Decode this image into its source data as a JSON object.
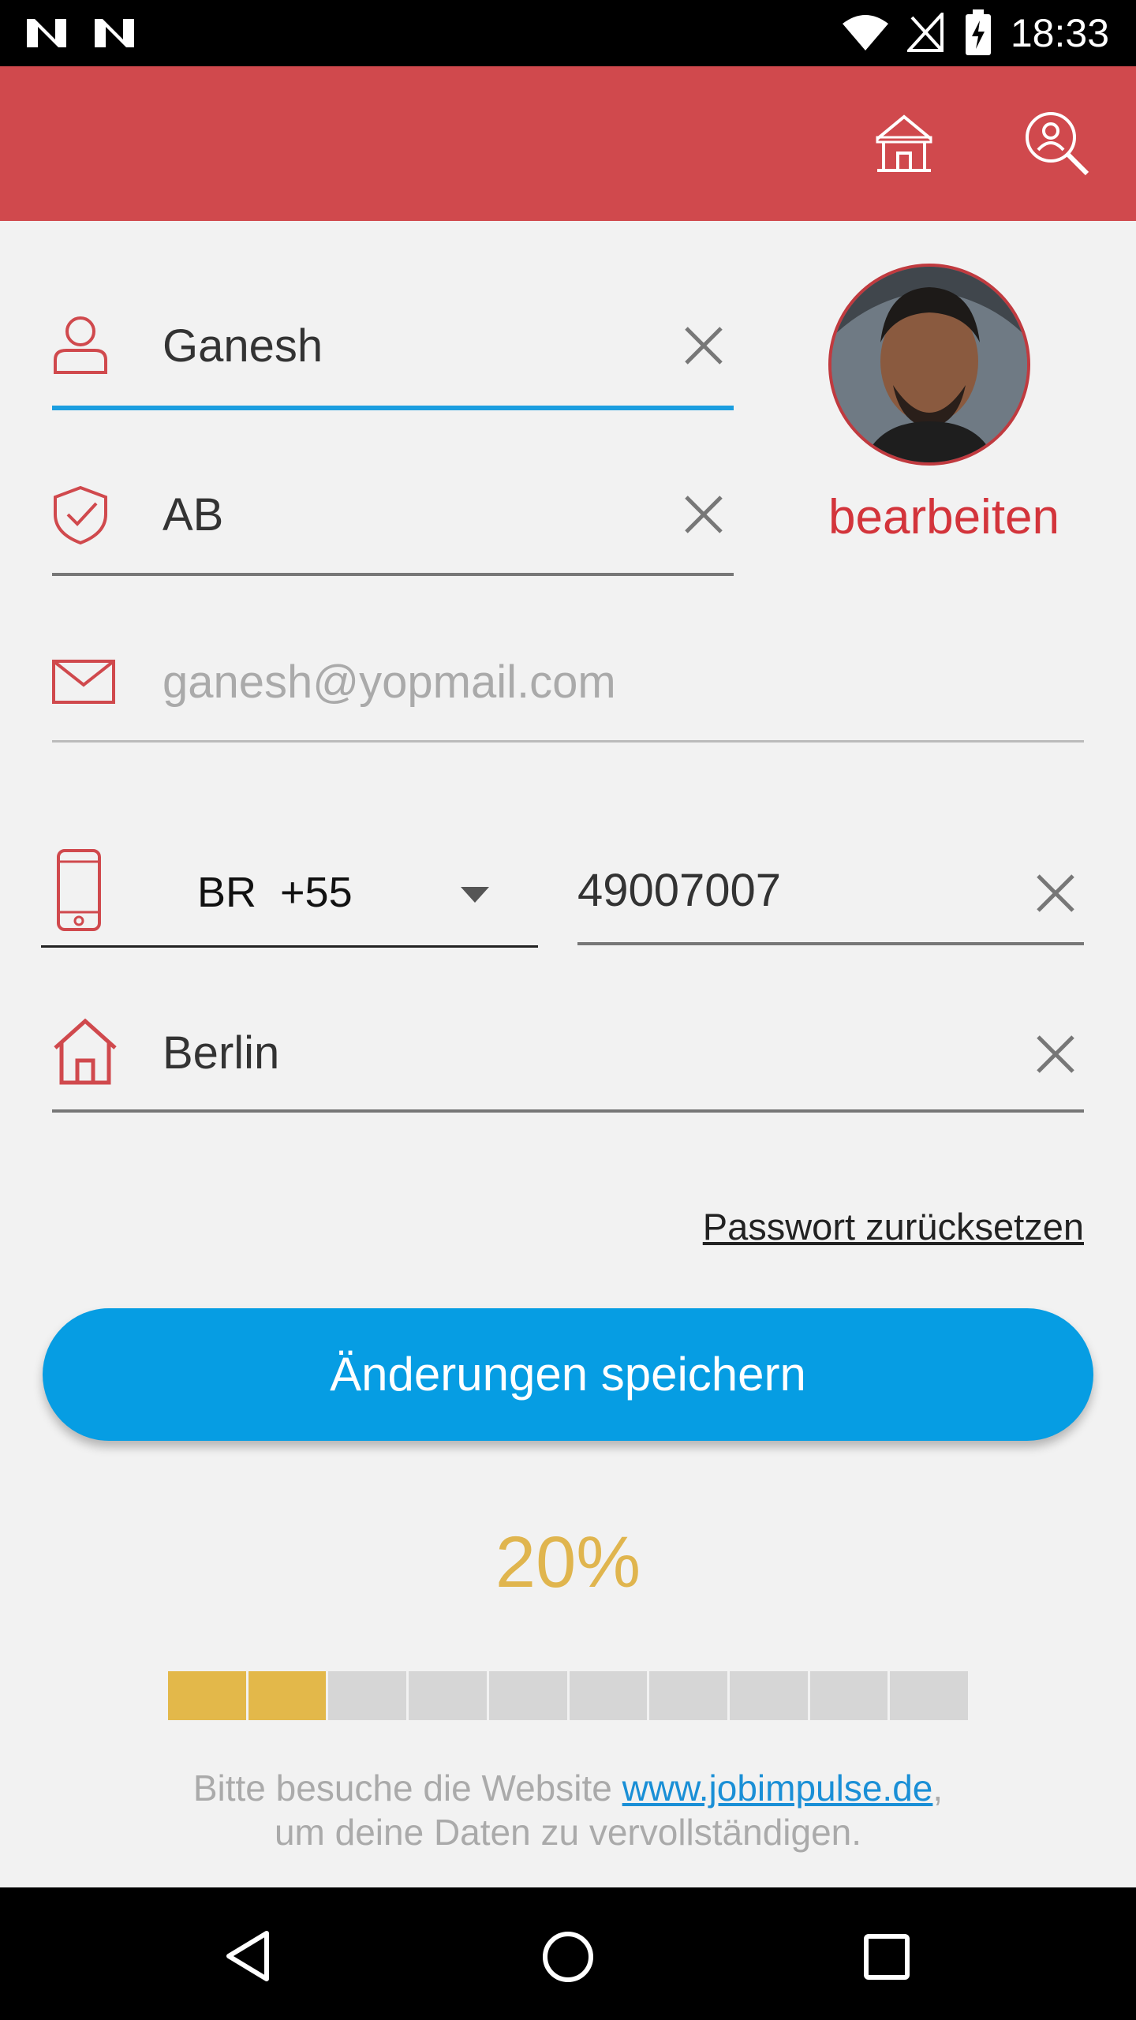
{
  "status_bar": {
    "time": "18:33"
  },
  "toolbar": {
    "home_icon": "home-icon",
    "profile_search_icon": "profile-search-icon"
  },
  "form": {
    "first_name": {
      "value": "Ganesh"
    },
    "last_name": {
      "value": "AB"
    },
    "email": {
      "placeholder": "ganesh@yopmail.com"
    },
    "phone": {
      "country_code": "BR  +55",
      "number": "49007007"
    },
    "city": {
      "value": "Berlin"
    }
  },
  "avatar": {
    "edit_label": "bearbeiten"
  },
  "password_reset_label": "Passwort zurücksetzen",
  "save_button_label": "Änderungen speichern",
  "progress": {
    "label": "20%",
    "fraction": 0.2,
    "segments": 10,
    "filled_segments": 2
  },
  "hint": {
    "prefix": "Bitte besuche die Website ",
    "link": "www.jobimpulse.de",
    "suffix": ",",
    "line2": "um deine Daten zu vervollständigen."
  },
  "colors": {
    "accent_red": "#d0494d",
    "primary_blue": "#069de3",
    "progress_gold": "#e3b84a"
  }
}
